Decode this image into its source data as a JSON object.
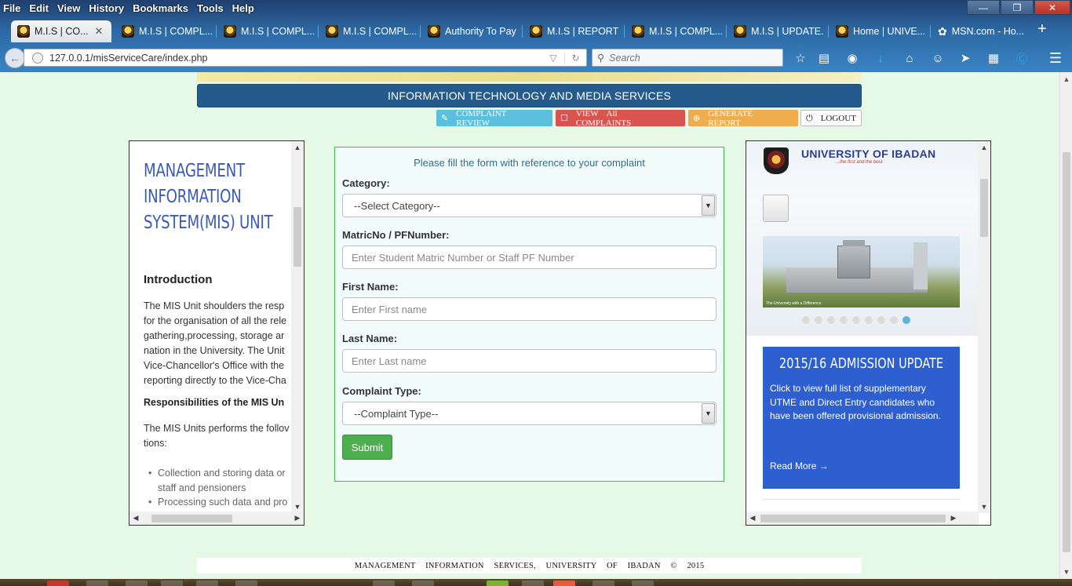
{
  "browser": {
    "menu": [
      "File",
      "Edit",
      "View",
      "History",
      "Bookmarks",
      "Tools",
      "Help"
    ],
    "tabs": [
      {
        "label": "M.I.S | CO...",
        "active": true
      },
      {
        "label": "M.I.S | COMPL..."
      },
      {
        "label": "M.I.S | COMPL..."
      },
      {
        "label": "M.I.S | COMPL..."
      },
      {
        "label": "Authority To Pay"
      },
      {
        "label": "M.I.S | REPORT ..."
      },
      {
        "label": "M.I.S | COMPL..."
      },
      {
        "label": "M.I.S | UPDATE..."
      },
      {
        "label": "Home | UNIVE..."
      },
      {
        "label": "MSN.com - Ho..."
      }
    ],
    "url": "127.0.0.1/misServiceCare/index.php",
    "search_placeholder": "Search"
  },
  "header": {
    "bar_title": "INFORMATION TECHNOLOGY AND MEDIA SERVICES",
    "actions": {
      "review": "COMPLAINT REVIEW",
      "view_all": "VIEW All COMPLAINTS",
      "report": "GENERATE REPORT",
      "logout": "LOGOUT"
    }
  },
  "left_panel": {
    "title": "MANAGEMENT INFORMATION SYSTEM(MIS) UNIT",
    "intro_heading": "Introduction",
    "intro_text": "The MIS Unit shoulders the resp\nfor the organisation of all the rele\ngathering,processing, storage ar\nnation in the University. The Unit\nVice-Chancellor's Office with the\nreporting directly to the Vice-Cha",
    "resp_heading": "Responsibilities of the MIS Un",
    "resp_text": "The MIS Units performs the follov\ntions:",
    "resp_items": [
      "Collection and storing data or\nstaff and pensioners",
      "Processing such data and pro"
    ]
  },
  "form": {
    "intro": "Please fill the form with reference to your complaint",
    "category_label": "Category:",
    "category_value": "--Select Category--",
    "matric_label": "MatricNo / PFNumber:",
    "matric_placeholder": "Enter Student Matric Number or Staff PF Number",
    "first_label": "First Name:",
    "first_placeholder": "Enter First name",
    "last_label": "Last Name:",
    "last_placeholder": "Enter Last name",
    "type_label": "Complaint Type:",
    "type_value": "--Complaint Type--",
    "submit": "Submit"
  },
  "right_panel": {
    "uni_name": "UNIVERSITY OF IBADAN",
    "motto": "...the first and the best",
    "image_caption": "The University with a Difference",
    "slide_count": 9,
    "active_slide": 9,
    "admission_title": "2015/16 ADMISSION UPDATE",
    "admission_body": "Click to view full list of supplementary UTME and Direct Entry candidates who have been offered provisional admission.",
    "read_more": "Read More →"
  },
  "footer": "MANAGEMENT INFORMATION SERVICES, UNIVERSITY OF IBADAN © 2015",
  "colors": {
    "page_bg": "#e6f8e6",
    "header_bar": "#245b8c",
    "review_btn": "#5bc0de",
    "view_btn": "#d9534f",
    "report_btn": "#f0ad4e",
    "submit_btn": "#4cae4c",
    "title_blue": "#3a5ab8",
    "admission_box": "#2e5fd0"
  }
}
